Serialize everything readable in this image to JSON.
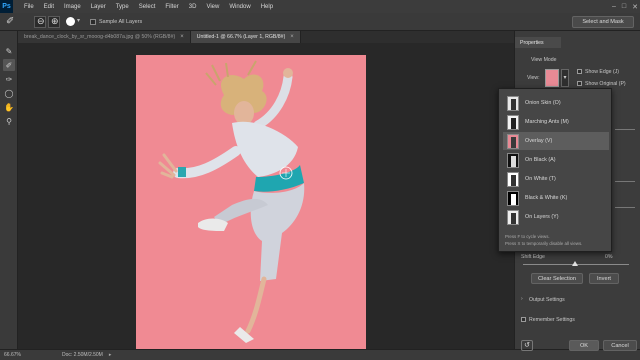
{
  "app": {
    "logo": "Ps"
  },
  "menu": [
    "File",
    "Edit",
    "Image",
    "Layer",
    "Type",
    "Select",
    "Filter",
    "3D",
    "View",
    "Window",
    "Help"
  ],
  "window_controls": [
    "–",
    "□",
    "✕"
  ],
  "options": {
    "sample_all_layers": "Sample All Layers",
    "select_and_mask": "Select and Mask"
  },
  "tabs": [
    {
      "label": "break_dance_clock_by_sr_mooog-d4b087a.jpg @ 50% (RGB/8#)",
      "active": false
    },
    {
      "label": "Untitled-1 @ 66.7% (Layer 1, RGB/8#)",
      "active": true
    }
  ],
  "tools": [
    "brush-icon",
    "refine-brush-icon",
    "quick-selection-icon",
    "lasso-icon",
    "hand-icon",
    "zoom-icon"
  ],
  "status": {
    "zoom": "66.67%",
    "doc": "Doc: 2.50M/2.50M"
  },
  "panel": {
    "tab": "Properties",
    "view_mode_label": "View Mode",
    "view_label": "View:",
    "show_edge": "Show Edge (J)",
    "show_original": "Show Original (P)",
    "shift_edge_label": "Shift Edge",
    "shift_edge_value": "0%",
    "clear_selection": "Clear Selection",
    "invert": "Invert",
    "output_settings": "Output Settings",
    "remember_settings": "Remember Settings",
    "ok": "OK",
    "cancel": "Cancel"
  },
  "view_popup": {
    "items": [
      {
        "label": "Onion Skin (O)",
        "thumb": "#e8e8e8",
        "selected": false
      },
      {
        "label": "Marching Ants (M)",
        "thumb": "#f2f2f2",
        "selected": false
      },
      {
        "label": "Overlay (V)",
        "thumb": "#e88a95",
        "selected": true
      },
      {
        "label": "On Black (A)",
        "thumb": "#111111",
        "selected": false
      },
      {
        "label": "On White (T)",
        "thumb": "#ffffff",
        "selected": false
      },
      {
        "label": "Black & White (K)",
        "thumb": "#000000",
        "selected": false
      },
      {
        "label": "On Layers (Y)",
        "thumb": "#eeeeee",
        "selected": false
      }
    ],
    "hint1": "Press F to cycle views.",
    "hint2": "Press X to temporarily disable all views."
  },
  "colors": {
    "canvas": "#f08a93",
    "accent": "#31a8ff"
  }
}
